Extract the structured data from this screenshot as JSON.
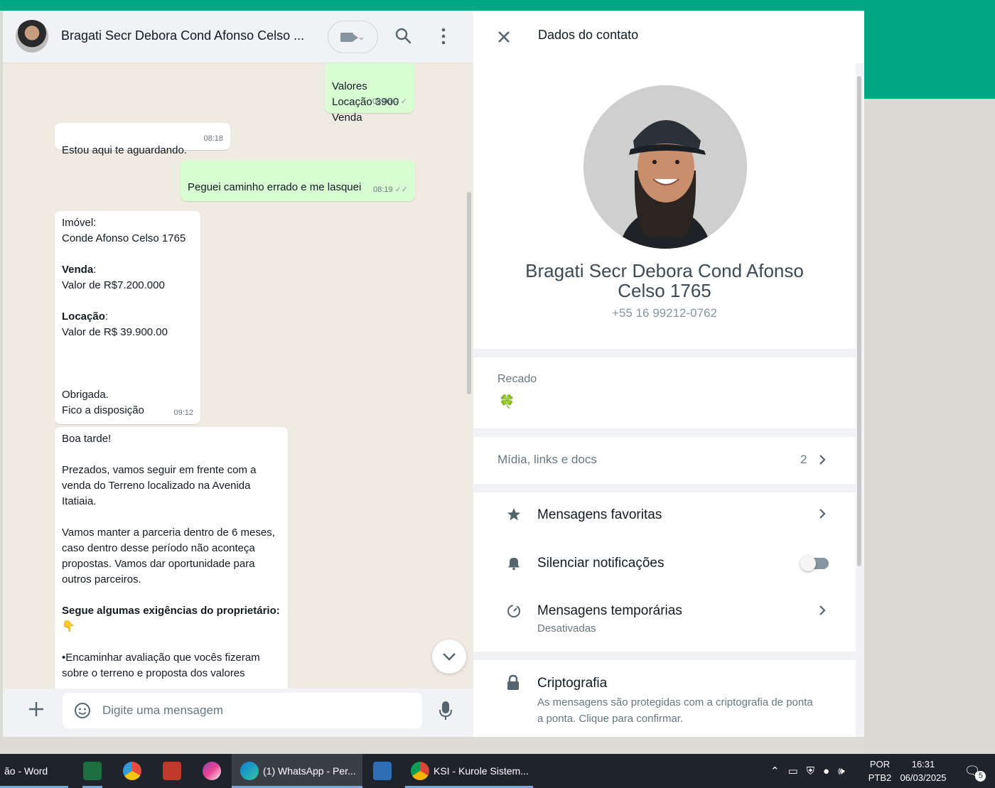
{
  "colors": {
    "accent": "#00a884",
    "incoming": "#ffffff",
    "outgoing": "#d9fdd3",
    "panel_bg": "#f0f2f5"
  },
  "chat": {
    "header": {
      "title": "Bragati Secr Debora Cond Afonso Celso ...",
      "video_caret": "⌄"
    },
    "messages": [
      {
        "type": "out",
        "text": "Valores\nLocação 3900\nVenda",
        "time": "08:06",
        "ticks": "✓✓"
      },
      {
        "type": "in",
        "text": "Estou aqui te aguardando.",
        "time": "08:18"
      },
      {
        "type": "out",
        "text": "Peguei caminho errado e me lasquei",
        "time": "08:19",
        "ticks": "✓✓"
      },
      {
        "type": "in",
        "property_label": "Imóvel:",
        "property_value": "Conde Afonso Celso 1765",
        "sale_label": "Venda",
        "sale_value": "Valor de R$7.200.000",
        "rent_label": "Locação",
        "rent_value": "Valor de R$ 39.900.00",
        "closing_1": "Obrigada.",
        "closing_2": "Fico a disposição",
        "time": "09:12"
      },
      {
        "type": "in",
        "greeting": "Boa tarde!",
        "para1": "Prezados, vamos seguir em frente com a venda do Terreno localizado na Avenida Itatiaia.",
        "para2": "Vamos manter a parceria dentro de 6 meses, caso dentro desse período não aconteça propostas. Vamos dar oportunidade para outros parceiros.",
        "para3_bold": "Segue algumas exigências do proprietário:",
        "para3_emoji": "👇",
        "para4": "•Encaminhar avaliação que vocês fizeram sobre o terreno e proposta dos valores"
      }
    ],
    "composer": {
      "placeholder": "Digite uma mensagem"
    }
  },
  "contact_panel": {
    "title": "Dados do contato",
    "name": "Bragati Secr Debora Cond Afonso Celso 1765",
    "phone": "+55 16 99212-0762",
    "about_label": "Recado",
    "about_value": "🍀",
    "media": {
      "label": "Mídia, links e docs",
      "count": "2"
    },
    "settings": [
      {
        "label": "Mensagens favoritas",
        "icon": "star-icon"
      },
      {
        "label": "Silenciar notificações",
        "icon": "bell-icon",
        "toggle": false
      },
      {
        "label": "Mensagens temporárias",
        "sub": "Desativadas",
        "icon": "timer-icon"
      }
    ],
    "encryption": {
      "title": "Criptografia",
      "description": "As mensagens são protegidas com a criptografia de ponta a ponta. Clique para confirmar."
    }
  },
  "taskbar": {
    "items": [
      {
        "label": "ão - Word",
        "icon": "word-icon"
      },
      {
        "label": "",
        "icon": "excel-icon"
      },
      {
        "label": "",
        "icon": "app-icon"
      },
      {
        "label": "",
        "icon": "pdf-icon"
      },
      {
        "label": "",
        "icon": "paint-icon"
      },
      {
        "label": "(1) WhatsApp - Per...",
        "icon": "edge-icon",
        "active": true
      },
      {
        "label": "",
        "icon": "calculator-icon"
      },
      {
        "label": "KSI - Kurole Sistem...",
        "icon": "chrome-icon"
      }
    ],
    "tray": {
      "language_line1": "POR",
      "language_line2": "PTB2",
      "time": "16:31",
      "date": "06/03/2025",
      "notification_count": "5"
    }
  }
}
